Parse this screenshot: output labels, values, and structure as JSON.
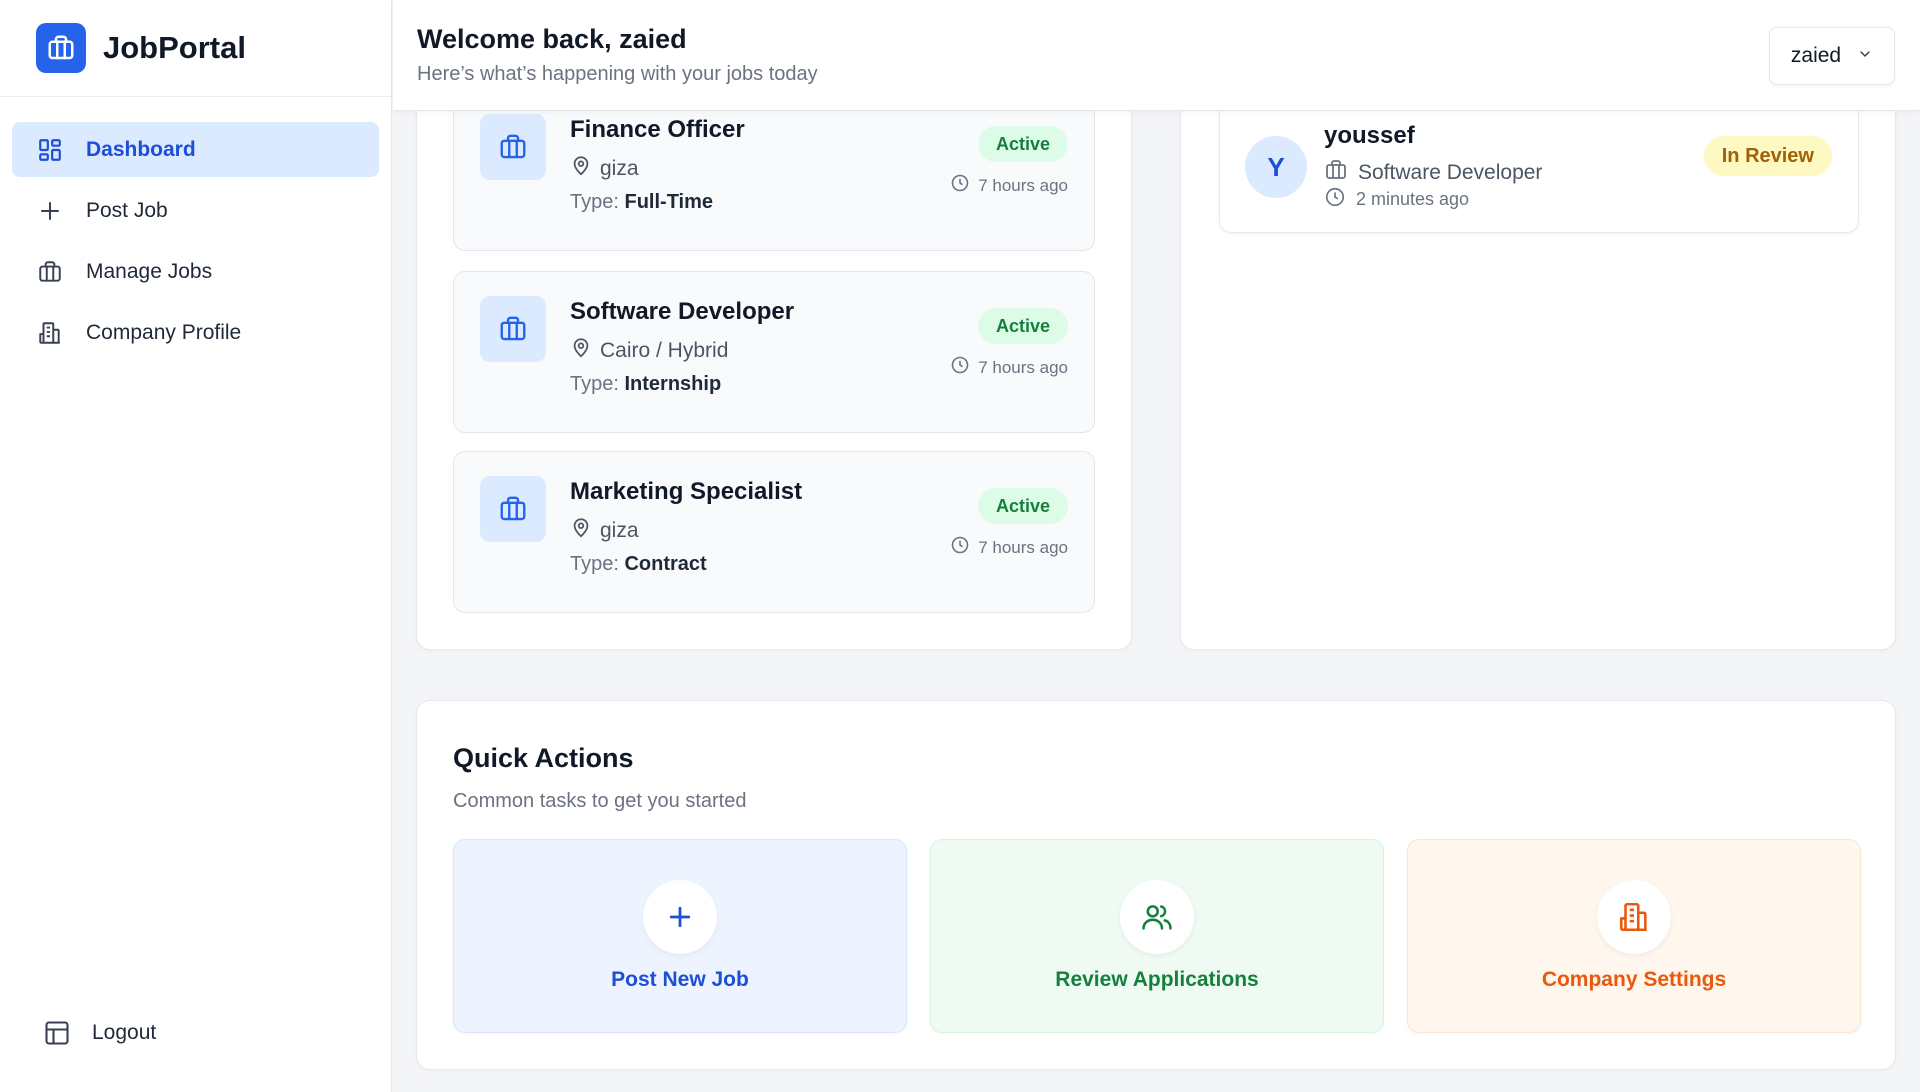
{
  "app": {
    "name": "JobPortal"
  },
  "colors": {
    "primary": "#2563eb",
    "active_green": "#15803d",
    "review_yellow": "#a16207",
    "orange": "#ea580c"
  },
  "sidebar": {
    "items": [
      {
        "label": "Dashboard",
        "icon": "dashboard-icon",
        "active": true
      },
      {
        "label": "Post Job",
        "icon": "plus-icon",
        "active": false
      },
      {
        "label": "Manage Jobs",
        "icon": "briefcase-icon",
        "active": false
      },
      {
        "label": "Company Profile",
        "icon": "building-icon",
        "active": false
      }
    ],
    "logout_label": "Logout"
  },
  "header": {
    "title": "Welcome back, zaied",
    "subtitle": "Here’s what’s happening with your jobs today",
    "user_name": "zaied"
  },
  "jobs": [
    {
      "title": "Finance Officer",
      "location": "giza",
      "type_label": "Type:",
      "type": "Full-Time",
      "status": "Active",
      "time": "7 hours ago"
    },
    {
      "title": "Software Developer",
      "location": "Cairo / Hybrid",
      "type_label": "Type:",
      "type": "Internship",
      "status": "Active",
      "time": "7 hours ago"
    },
    {
      "title": "Marketing Specialist",
      "location": "giza",
      "type_label": "Type:",
      "type": "Contract",
      "status": "Active",
      "time": "7 hours ago"
    }
  ],
  "applications": [
    {
      "initial": "Y",
      "name": "youssef",
      "role": "Software Developer",
      "time": "2 minutes ago",
      "status": "In Review"
    }
  ],
  "quick_actions": {
    "title": "Quick Actions",
    "subtitle": "Common tasks to get you started",
    "items": [
      {
        "label": "Post New Job",
        "icon": "plus-icon"
      },
      {
        "label": "Review Applications",
        "icon": "users-icon"
      },
      {
        "label": "Company Settings",
        "icon": "building-icon"
      }
    ]
  }
}
